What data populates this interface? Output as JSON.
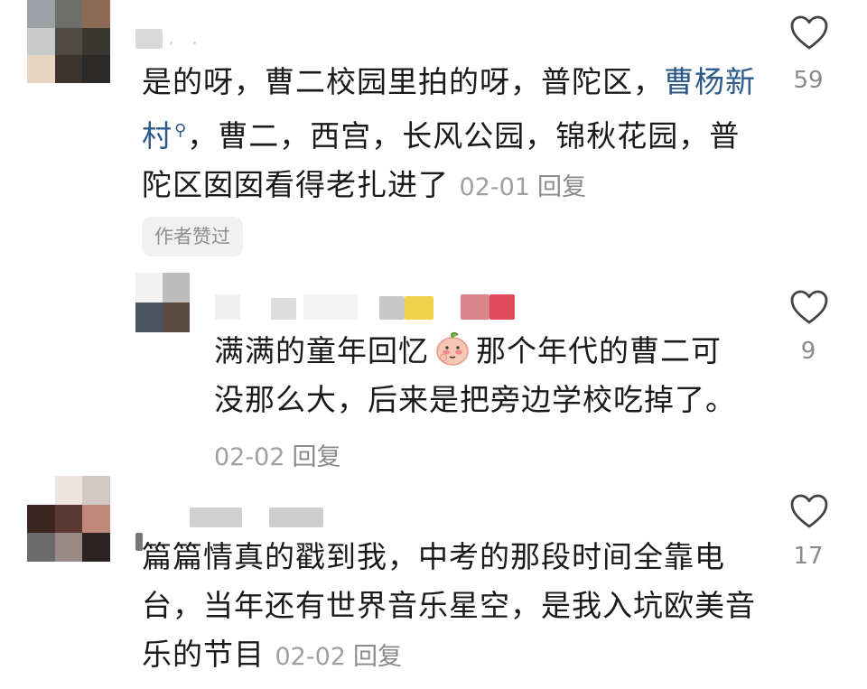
{
  "comments": [
    {
      "text_part1": "是的呀，曹二校园里拍的呀，普陀区，",
      "link": "曹杨新村",
      "text_part2": "，曹二，西宫，长风公园，锦秋花园，普陀区囡囡看得老扎进了",
      "date": "02-01",
      "reply": "回复",
      "likes": "59",
      "badge": "作者赞过"
    },
    {
      "text_part1": "满满的童年回忆",
      "emoji": "peach-shy-emoji",
      "text_part2": "那个年代的曹二可没那么大，后来是把旁边学校吃掉了。",
      "date": "02-02",
      "reply": "回复",
      "likes": "9"
    },
    {
      "text": "篇篇情真的戳到我，中考的那段时间全靠电台，当年还有世界音乐星空，是我入坑欧美音乐的节目",
      "date": "02-02",
      "reply": "回复",
      "likes": "17"
    }
  ],
  "icons": {
    "like": "heart-outline-icon",
    "link": "search-icon"
  },
  "colors": {
    "link": "#2d5a8c",
    "meta": "#a0a0a0",
    "badge_bg": "#f1f1f1"
  }
}
